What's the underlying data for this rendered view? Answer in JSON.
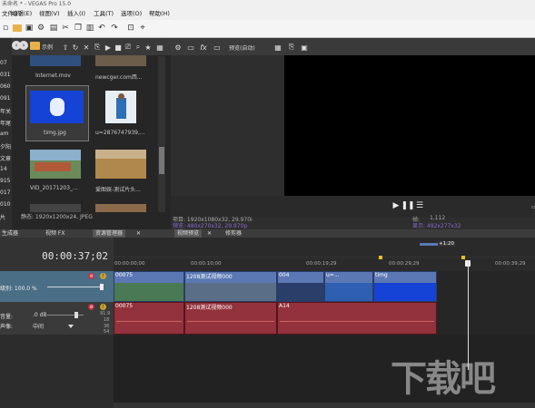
{
  "window": {
    "title": "未命名 * - VEGAS Pro 15.0"
  },
  "menu": [
    "文件(F)",
    "编辑(E)",
    "视图(V)",
    "插入(I)",
    "工具(T)",
    "选项(O)",
    "帮助(H)"
  ],
  "left_strip": [
    "07",
    "031",
    "060",
    "091",
    "年关",
    "年尾",
    "am",
    "夕阳",
    "文章",
    "14",
    "915",
    "017",
    "010",
    "片"
  ],
  "explorer": {
    "toolbar_label": "示例",
    "items": [
      {
        "label": "Internet.mov"
      },
      {
        "label": "newcger.com西..."
      },
      {
        "label": "timg.jpg"
      },
      {
        "label": "u=2876747939,..."
      },
      {
        "label": "VID_20171203_..."
      },
      {
        "label": "爱图娱-测试片头..."
      }
    ],
    "status": "静态: 1920x1200x24, JPEG",
    "tabs": [
      "生成器",
      "视频 FX",
      "资源管理器"
    ]
  },
  "preview": {
    "quality": "预览(自动)",
    "info_left": [
      "项目: 1920x1080x32, 29.970i",
      "预览: 480x270x32, 29.970p",
      "显示: 492x277x32"
    ],
    "info_right": [
      "帧:",
      "1,112",
      "显示: 492x277x32"
    ],
    "tabs": [
      "视频预览",
      "修剪器"
    ]
  },
  "timeline": {
    "current_time": "00:00:37;02",
    "ruler_labels": [
      "00:00:00;00",
      "00:00:10;00",
      "00:00:19;29",
      "00:00:29;29",
      "00:00:39;29"
    ],
    "region_marker": "+1:20",
    "video_track": {
      "level": "级别: 100.0 %"
    },
    "audio_track": {
      "volume_label": "音量:",
      "volume_value": ".0 dB",
      "pan_label": "声像:",
      "pan_value": "中间",
      "meter": [
        "18",
        "36",
        "54"
      ],
      "meter_top": "91.9"
    },
    "video_clips": [
      {
        "label": "00075"
      },
      {
        "label": "1208测试视频000"
      },
      {
        "label": "004"
      },
      {
        "label": "u=..."
      },
      {
        "label": "timg"
      }
    ],
    "audio_clips": [
      {
        "label": "00075"
      },
      {
        "label": "1208测试视频000"
      },
      {
        "label": "A14"
      }
    ]
  },
  "watermark": "下载吧",
  "colors": {
    "video_clip": "#5b78b4",
    "audio_clip": "#93323c",
    "track_header": "#4a6e86"
  }
}
